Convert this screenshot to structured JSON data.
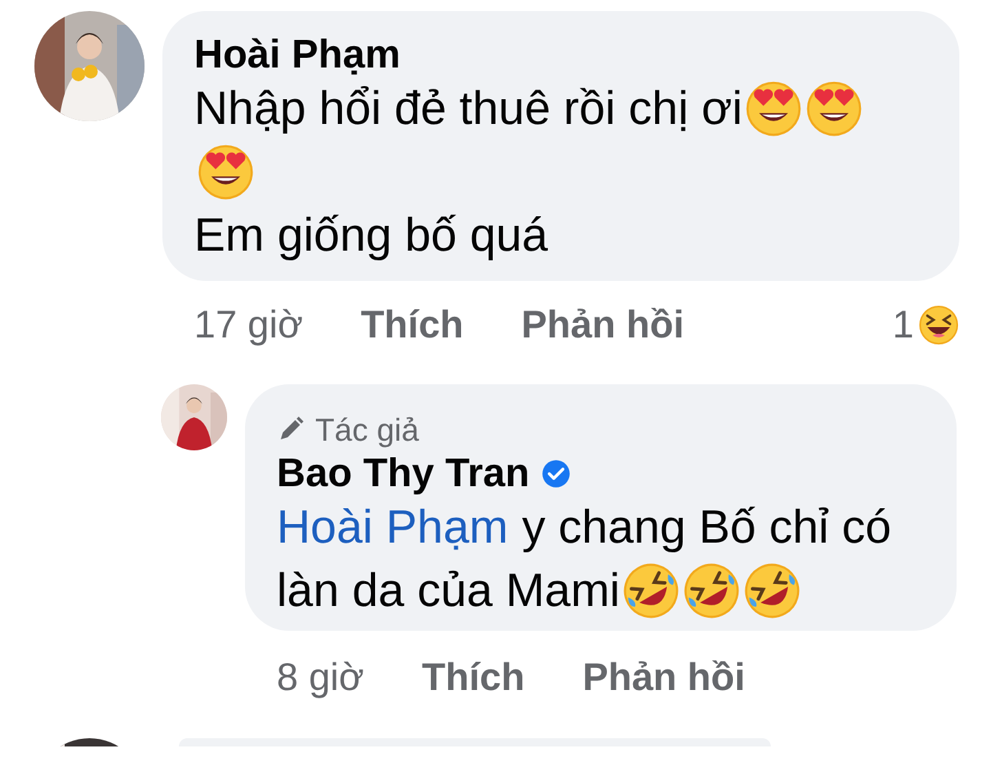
{
  "comment": {
    "author": "Hoài Phạm",
    "lines": [
      [
        {
          "kind": "text",
          "text": "Nhập hổi đẻ thuê rồi chị ơi"
        },
        {
          "kind": "heart_eyes"
        },
        {
          "kind": "heart_eyes"
        }
      ],
      [
        {
          "kind": "heart_eyes"
        }
      ],
      [
        {
          "kind": "text",
          "text": "Em giống bố quá"
        }
      ]
    ],
    "time": "17 giờ",
    "like": "Thích",
    "reply": "Phản hồi",
    "reaction": {
      "count": "1",
      "kind": "haha"
    }
  },
  "reply": {
    "role_label": "Tác giả",
    "author": "Bao Thy Tran",
    "verified": true,
    "lines": [
      [
        {
          "kind": "mention",
          "text": "Hoài Phạm"
        },
        {
          "kind": "text",
          "text": "y chang Bố chỉ có"
        }
      ],
      [
        {
          "kind": "text",
          "text": "làn da của Mami"
        },
        {
          "kind": "rofl"
        },
        {
          "kind": "rofl"
        },
        {
          "kind": "rofl"
        }
      ]
    ],
    "time": "8 giờ",
    "like": "Thích",
    "reply": "Phản hồi"
  }
}
